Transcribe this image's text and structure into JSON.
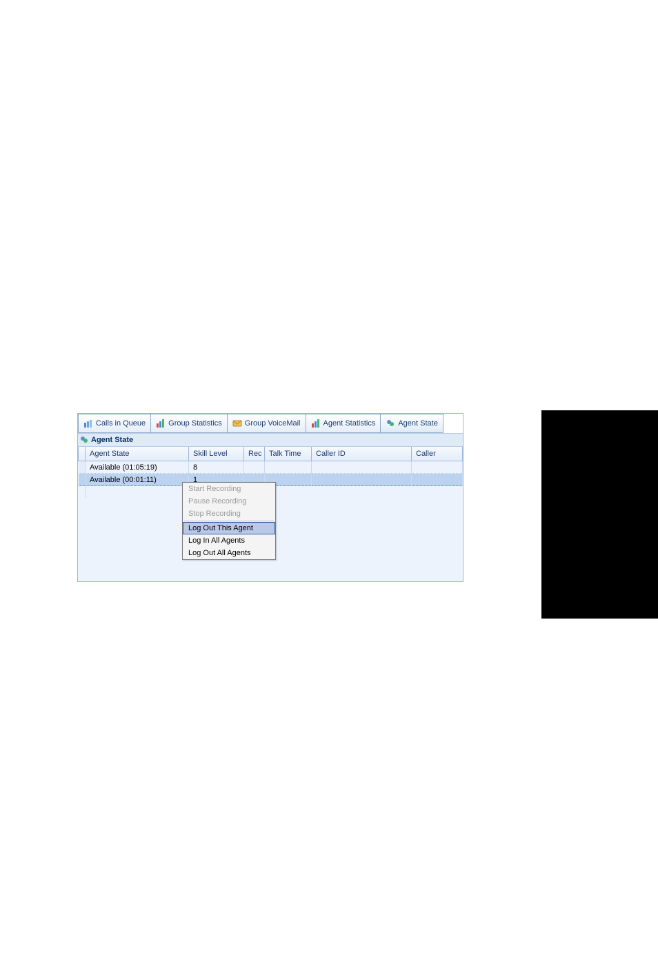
{
  "tabs": {
    "calls_in_queue": "Calls in Queue",
    "group_statistics": "Group Statistics",
    "group_voicemail": "Group VoiceMail",
    "agent_statistics": "Agent Statistics",
    "agent_state": "Agent State"
  },
  "panel": {
    "title": "Agent State"
  },
  "columns": {
    "agent_state": "Agent State",
    "skill_level": "Skill Level",
    "rec": "Rec",
    "talk_time": "Talk Time",
    "caller_id": "Caller ID",
    "caller_last": "Caller"
  },
  "rows": [
    {
      "state": "Available (01:05:19)",
      "skill": "8",
      "rec": "",
      "talk": "",
      "caller": ""
    },
    {
      "state": "Available (00:01:11)",
      "skill": "1",
      "rec": "",
      "talk": "",
      "caller": ""
    }
  ],
  "menu": {
    "start_recording": "Start Recording",
    "pause_recording": "Pause Recording",
    "stop_recording": "Stop Recording",
    "log_out_this": "Log Out This Agent",
    "log_in_all": "Log In All Agents",
    "log_out_all": "Log Out All Agents"
  }
}
